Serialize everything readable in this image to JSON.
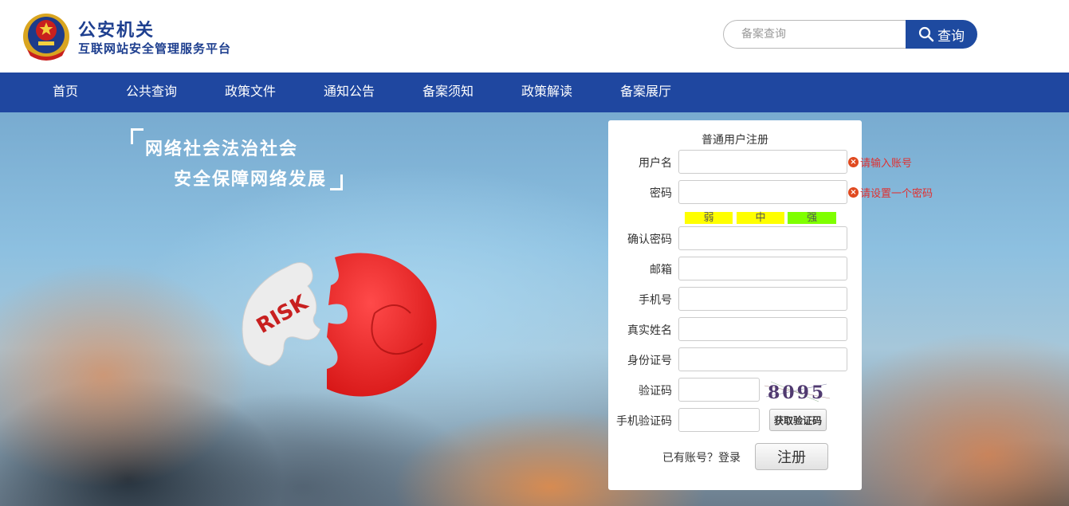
{
  "header": {
    "title": "公安机关",
    "subtitle": "互联网站安全管理服务平台",
    "search_placeholder": "备案查询",
    "search_button": "查询"
  },
  "nav": {
    "items": [
      "首页",
      "公共查询",
      "政策文件",
      "通知公告",
      "备案须知",
      "政策解读",
      "备案展厅"
    ]
  },
  "banner": {
    "slogan_line1": "网络社会法治社会",
    "slogan_line2": "安全保障网络发展",
    "puzzle_text": "RISK"
  },
  "form": {
    "title": "普通用户注册",
    "fields": [
      {
        "label": "用户名",
        "value": ""
      },
      {
        "label": "密码",
        "value": ""
      },
      {
        "label": "确认密码",
        "value": ""
      },
      {
        "label": "邮箱",
        "value": ""
      },
      {
        "label": "手机号",
        "value": ""
      },
      {
        "label": "真实姓名",
        "value": ""
      },
      {
        "label": "身份证号",
        "value": ""
      },
      {
        "label": "验证码",
        "value": ""
      },
      {
        "label": "手机验证码",
        "value": ""
      }
    ],
    "strength": {
      "weak": "弱",
      "medium": "中",
      "strong": "强",
      "weak_color": "#ffff00",
      "medium_color": "#ffff00",
      "strong_color": "#7fff00"
    },
    "captcha_text": "8095",
    "sms_button": "获取验证码",
    "login_prompt": "已有账号？登录",
    "register_button": "注册",
    "errors": {
      "username": "请输入账号",
      "password": "请设置一个密码"
    }
  },
  "colors": {
    "brand_blue": "#1e3f8f",
    "nav_blue": "#1f47a0",
    "error_red": "#e03030"
  }
}
